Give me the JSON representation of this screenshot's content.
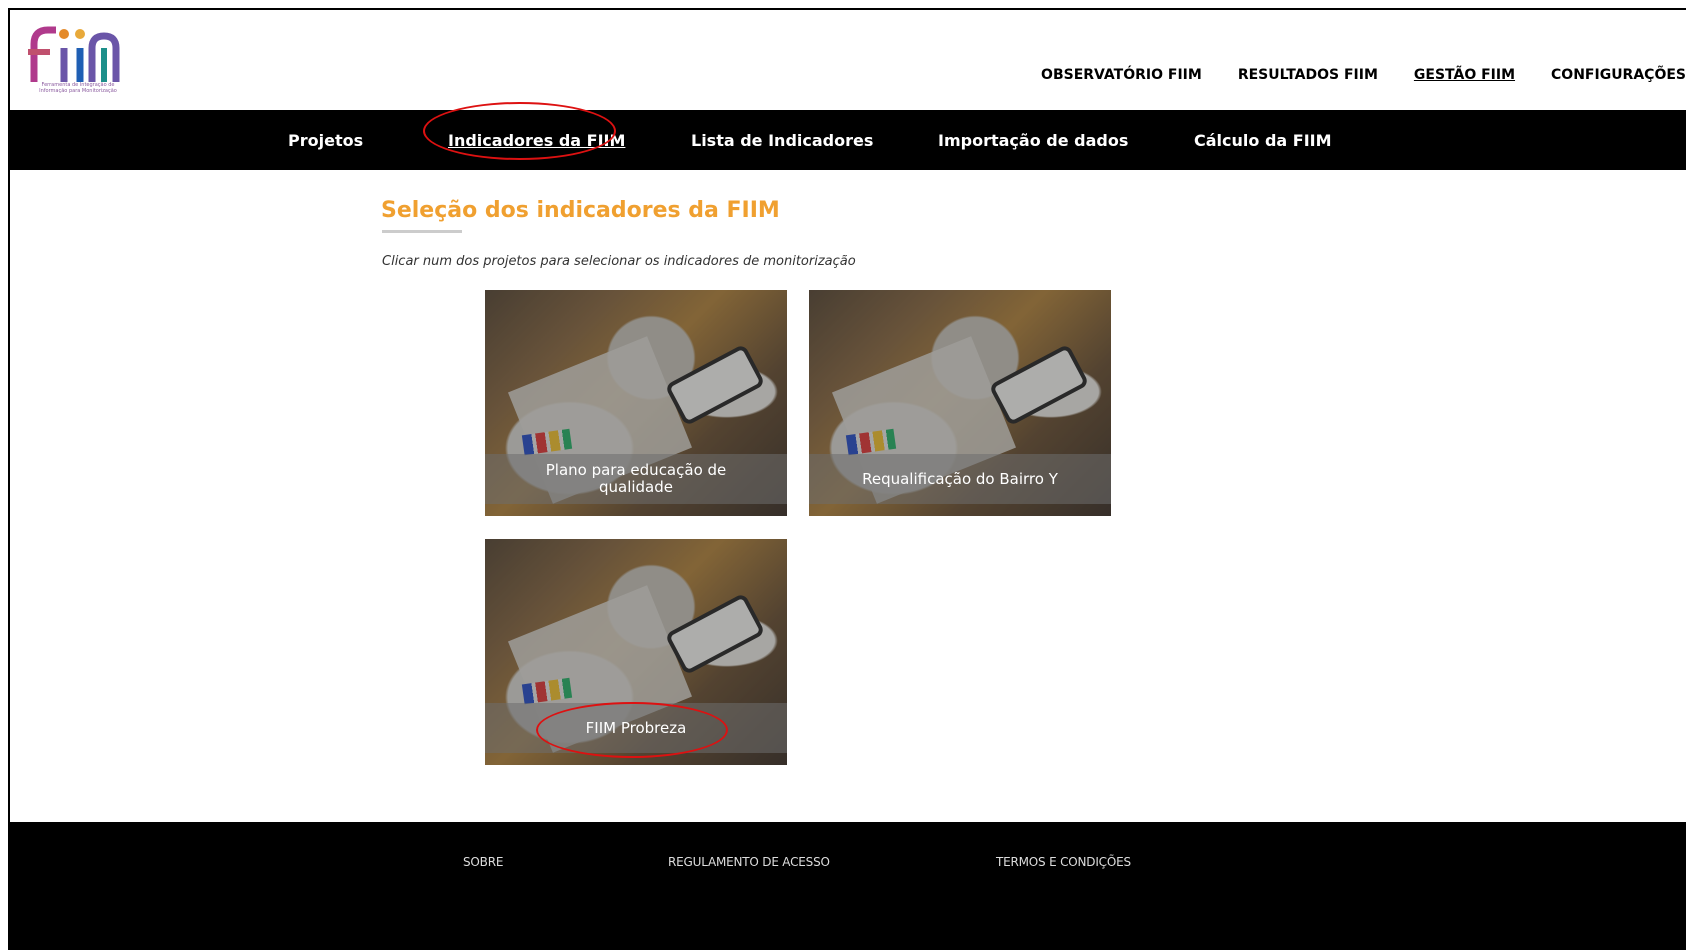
{
  "header": {
    "logo_text": "fiim",
    "logo_subtitle": "Ferramenta de Integração de Informação para Monitorização",
    "top_nav": [
      {
        "label": "OBSERVATÓRIO FIIM",
        "active": false
      },
      {
        "label": "RESULTADOS FIIM",
        "active": false
      },
      {
        "label": "GESTÃO FIIM",
        "active": true
      },
      {
        "label": "CONFIGURAÇÕES",
        "active": false
      }
    ]
  },
  "sub_nav": [
    {
      "label": "Projetos",
      "active": false
    },
    {
      "label": "Indicadores da FIIM",
      "active": true
    },
    {
      "label": "Lista de Indicadores",
      "active": false
    },
    {
      "label": "Importação de dados",
      "active": false
    },
    {
      "label": "Cálculo da FIIM",
      "active": false
    }
  ],
  "main": {
    "title": "Seleção dos indicadores da FIIM",
    "hint": "Clicar num dos projetos para selecionar os indicadores de monitorização",
    "projects": [
      {
        "title": "Plano para educação de qualidade"
      },
      {
        "title": "Requalificação do Bairro Y"
      },
      {
        "title": "FIIM Probreza"
      }
    ]
  },
  "footer": {
    "links": [
      "SOBRE",
      "REGULAMENTO DE ACESSO",
      "TERMOS E CONDIÇÕES"
    ]
  },
  "colors": {
    "title_accent": "#f0a030",
    "nav_bg": "#000000",
    "highlight_ring": "#dd1111"
  }
}
